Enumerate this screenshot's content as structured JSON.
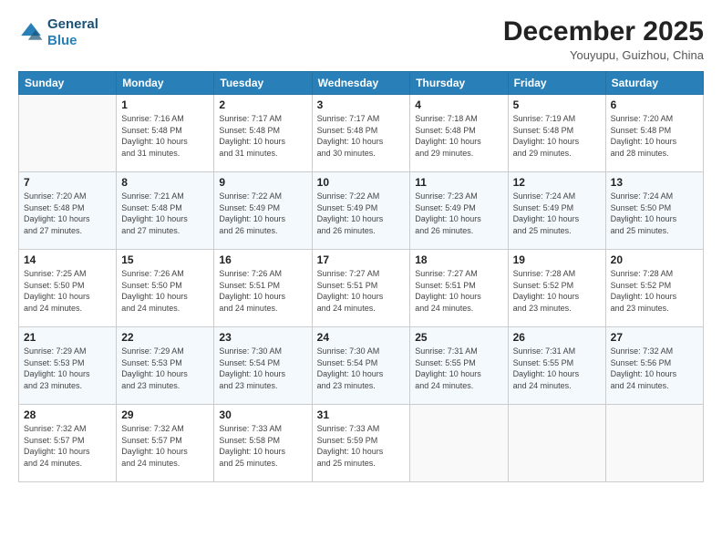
{
  "header": {
    "logo_line1": "General",
    "logo_line2": "Blue",
    "month": "December 2025",
    "location": "Youyupu, Guizhou, China"
  },
  "days_of_week": [
    "Sunday",
    "Monday",
    "Tuesday",
    "Wednesday",
    "Thursday",
    "Friday",
    "Saturday"
  ],
  "weeks": [
    [
      {
        "day": "",
        "info": ""
      },
      {
        "day": "1",
        "info": "Sunrise: 7:16 AM\nSunset: 5:48 PM\nDaylight: 10 hours\nand 31 minutes."
      },
      {
        "day": "2",
        "info": "Sunrise: 7:17 AM\nSunset: 5:48 PM\nDaylight: 10 hours\nand 31 minutes."
      },
      {
        "day": "3",
        "info": "Sunrise: 7:17 AM\nSunset: 5:48 PM\nDaylight: 10 hours\nand 30 minutes."
      },
      {
        "day": "4",
        "info": "Sunrise: 7:18 AM\nSunset: 5:48 PM\nDaylight: 10 hours\nand 29 minutes."
      },
      {
        "day": "5",
        "info": "Sunrise: 7:19 AM\nSunset: 5:48 PM\nDaylight: 10 hours\nand 29 minutes."
      },
      {
        "day": "6",
        "info": "Sunrise: 7:20 AM\nSunset: 5:48 PM\nDaylight: 10 hours\nand 28 minutes."
      }
    ],
    [
      {
        "day": "7",
        "info": "Sunrise: 7:20 AM\nSunset: 5:48 PM\nDaylight: 10 hours\nand 27 minutes."
      },
      {
        "day": "8",
        "info": "Sunrise: 7:21 AM\nSunset: 5:48 PM\nDaylight: 10 hours\nand 27 minutes."
      },
      {
        "day": "9",
        "info": "Sunrise: 7:22 AM\nSunset: 5:49 PM\nDaylight: 10 hours\nand 26 minutes."
      },
      {
        "day": "10",
        "info": "Sunrise: 7:22 AM\nSunset: 5:49 PM\nDaylight: 10 hours\nand 26 minutes."
      },
      {
        "day": "11",
        "info": "Sunrise: 7:23 AM\nSunset: 5:49 PM\nDaylight: 10 hours\nand 26 minutes."
      },
      {
        "day": "12",
        "info": "Sunrise: 7:24 AM\nSunset: 5:49 PM\nDaylight: 10 hours\nand 25 minutes."
      },
      {
        "day": "13",
        "info": "Sunrise: 7:24 AM\nSunset: 5:50 PM\nDaylight: 10 hours\nand 25 minutes."
      }
    ],
    [
      {
        "day": "14",
        "info": "Sunrise: 7:25 AM\nSunset: 5:50 PM\nDaylight: 10 hours\nand 24 minutes."
      },
      {
        "day": "15",
        "info": "Sunrise: 7:26 AM\nSunset: 5:50 PM\nDaylight: 10 hours\nand 24 minutes."
      },
      {
        "day": "16",
        "info": "Sunrise: 7:26 AM\nSunset: 5:51 PM\nDaylight: 10 hours\nand 24 minutes."
      },
      {
        "day": "17",
        "info": "Sunrise: 7:27 AM\nSunset: 5:51 PM\nDaylight: 10 hours\nand 24 minutes."
      },
      {
        "day": "18",
        "info": "Sunrise: 7:27 AM\nSunset: 5:51 PM\nDaylight: 10 hours\nand 24 minutes."
      },
      {
        "day": "19",
        "info": "Sunrise: 7:28 AM\nSunset: 5:52 PM\nDaylight: 10 hours\nand 23 minutes."
      },
      {
        "day": "20",
        "info": "Sunrise: 7:28 AM\nSunset: 5:52 PM\nDaylight: 10 hours\nand 23 minutes."
      }
    ],
    [
      {
        "day": "21",
        "info": "Sunrise: 7:29 AM\nSunset: 5:53 PM\nDaylight: 10 hours\nand 23 minutes."
      },
      {
        "day": "22",
        "info": "Sunrise: 7:29 AM\nSunset: 5:53 PM\nDaylight: 10 hours\nand 23 minutes."
      },
      {
        "day": "23",
        "info": "Sunrise: 7:30 AM\nSunset: 5:54 PM\nDaylight: 10 hours\nand 23 minutes."
      },
      {
        "day": "24",
        "info": "Sunrise: 7:30 AM\nSunset: 5:54 PM\nDaylight: 10 hours\nand 23 minutes."
      },
      {
        "day": "25",
        "info": "Sunrise: 7:31 AM\nSunset: 5:55 PM\nDaylight: 10 hours\nand 24 minutes."
      },
      {
        "day": "26",
        "info": "Sunrise: 7:31 AM\nSunset: 5:55 PM\nDaylight: 10 hours\nand 24 minutes."
      },
      {
        "day": "27",
        "info": "Sunrise: 7:32 AM\nSunset: 5:56 PM\nDaylight: 10 hours\nand 24 minutes."
      }
    ],
    [
      {
        "day": "28",
        "info": "Sunrise: 7:32 AM\nSunset: 5:57 PM\nDaylight: 10 hours\nand 24 minutes."
      },
      {
        "day": "29",
        "info": "Sunrise: 7:32 AM\nSunset: 5:57 PM\nDaylight: 10 hours\nand 24 minutes."
      },
      {
        "day": "30",
        "info": "Sunrise: 7:33 AM\nSunset: 5:58 PM\nDaylight: 10 hours\nand 25 minutes."
      },
      {
        "day": "31",
        "info": "Sunrise: 7:33 AM\nSunset: 5:59 PM\nDaylight: 10 hours\nand 25 minutes."
      },
      {
        "day": "",
        "info": ""
      },
      {
        "day": "",
        "info": ""
      },
      {
        "day": "",
        "info": ""
      }
    ]
  ]
}
